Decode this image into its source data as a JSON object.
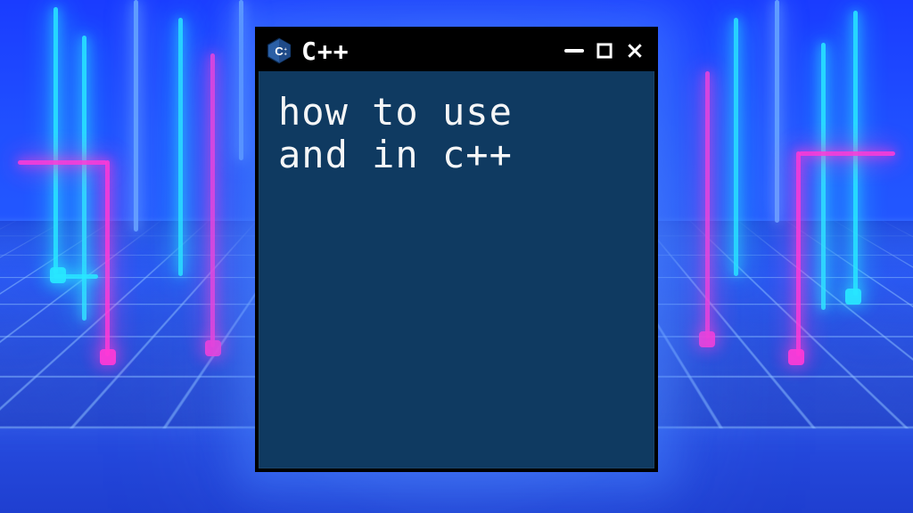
{
  "window": {
    "title": "C++",
    "body_line1": "how to use",
    "body_line2": "and in c++"
  },
  "icons": {
    "logo": "cpp-logo-icon",
    "minimize": "minimize-icon",
    "maximize": "maximize-icon",
    "close": "close-icon"
  }
}
